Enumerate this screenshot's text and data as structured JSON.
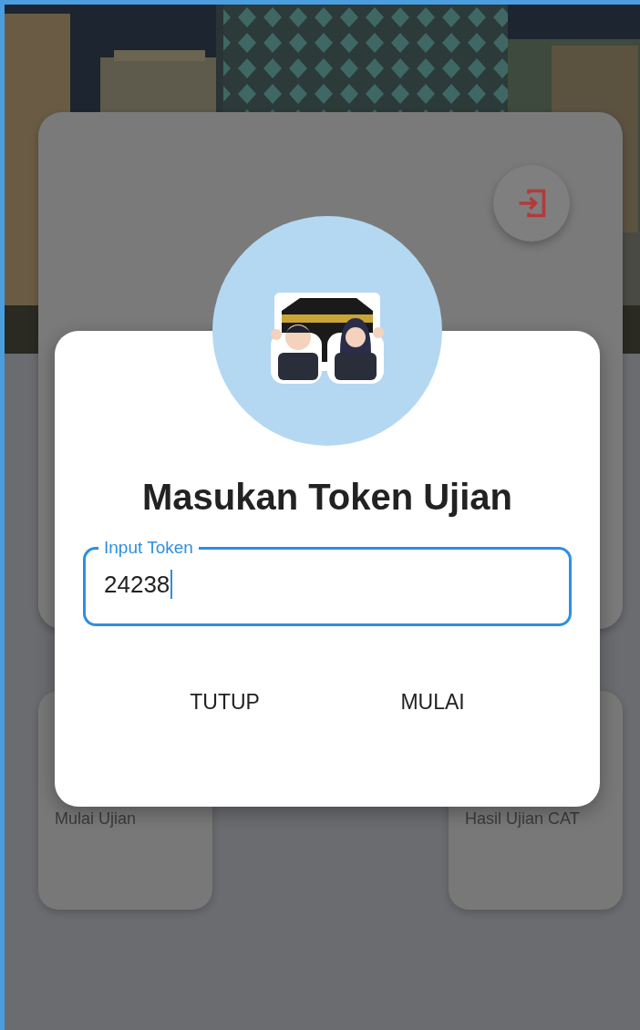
{
  "menu_cards": [
    {
      "label": "Mulai Ujian"
    },
    {
      "label": "Hasil Ujian CAT"
    }
  ],
  "dialog": {
    "title": "Masukan Token Ujian",
    "token_field": {
      "label": "Input Token",
      "value": "24238",
      "focused": true
    },
    "buttons": [
      "TUTUP",
      "MULAI"
    ]
  }
}
